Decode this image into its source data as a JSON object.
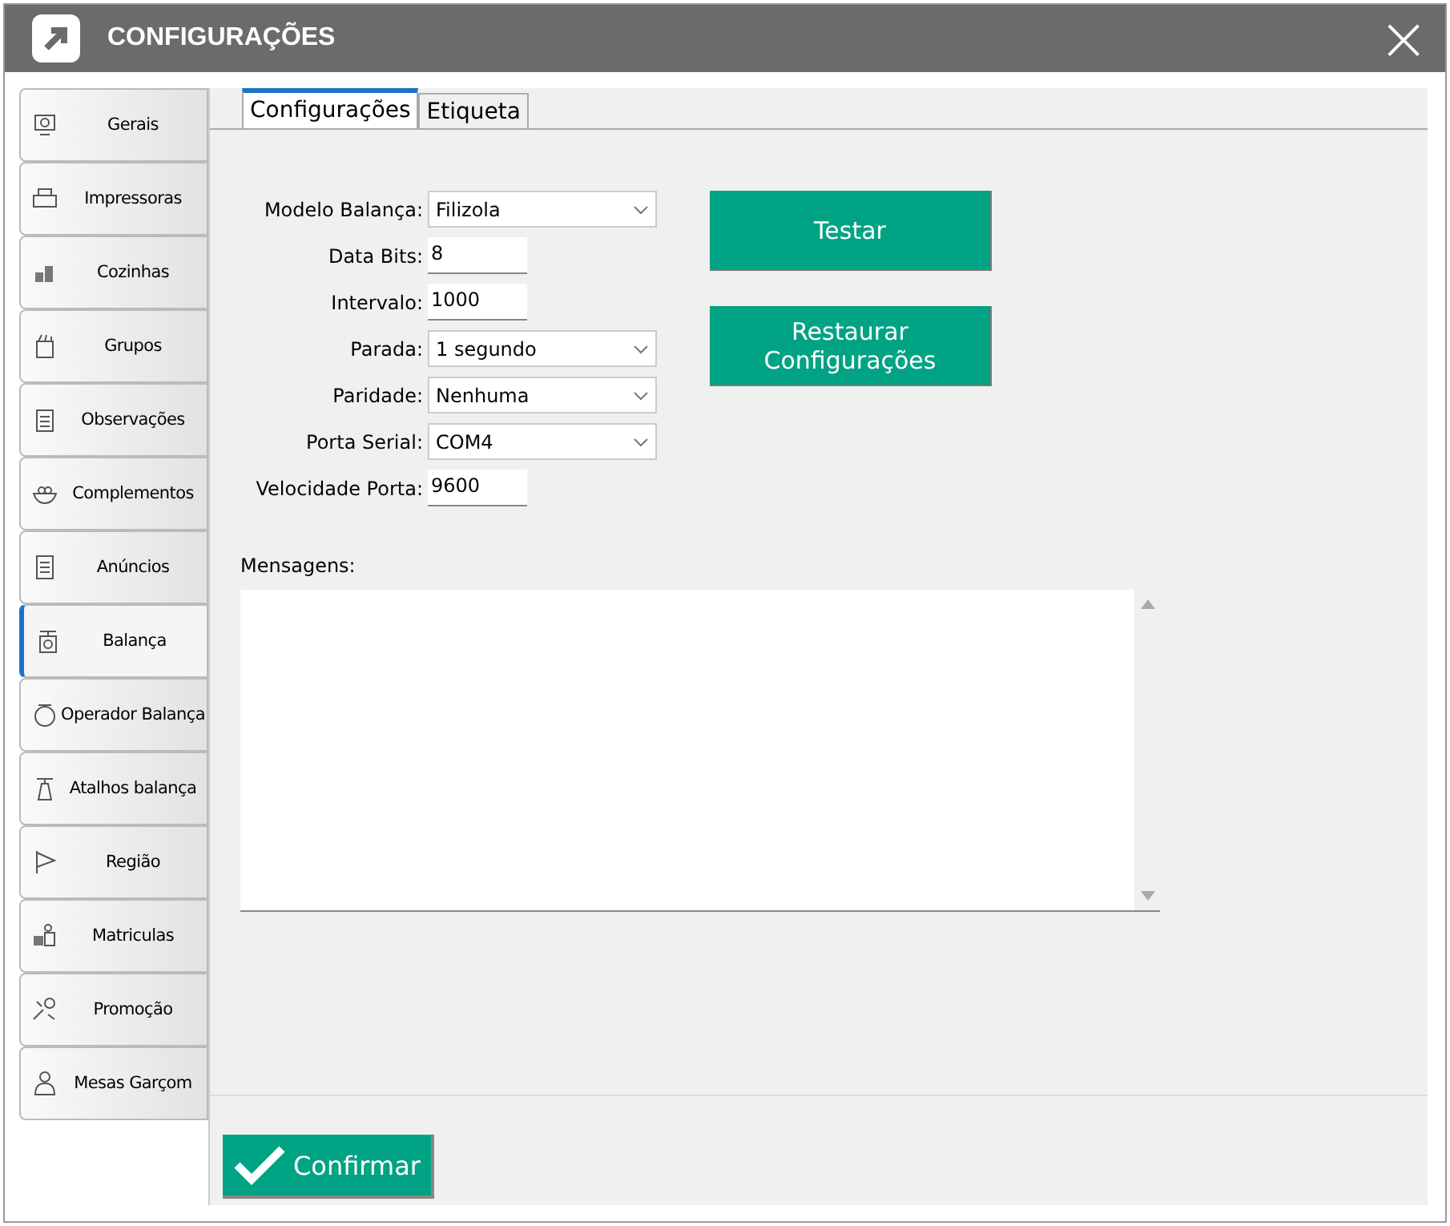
{
  "window": {
    "title": "CONFIGURAÇÕES",
    "close": "×"
  },
  "sidebar": {
    "items": [
      {
        "label": "Gerais",
        "selected": false
      },
      {
        "label": "Impressoras",
        "selected": false
      },
      {
        "label": "Cozinhas",
        "selected": false
      },
      {
        "label": "Grupos",
        "selected": false
      },
      {
        "label": "Observações",
        "selected": false
      },
      {
        "label": "Complementos",
        "selected": false
      },
      {
        "label": "Anúncios",
        "selected": false
      },
      {
        "label": "Balança",
        "selected": true
      },
      {
        "label": "Operador  Balança",
        "selected": false
      },
      {
        "label": "Atalhos balança",
        "selected": false
      },
      {
        "label": "Região",
        "selected": false
      },
      {
        "label": "Matriculas",
        "selected": false
      },
      {
        "label": "Promoção",
        "selected": false
      },
      {
        "label": "Mesas Garçom",
        "selected": false
      }
    ]
  },
  "tabs": [
    {
      "label": "Configurações",
      "selected": true
    },
    {
      "label": "Etiqueta",
      "selected": false
    }
  ],
  "form": [
    {
      "label": "Modelo Balança:",
      "kind": "select",
      "value": "Filizola"
    },
    {
      "label": "Data Bits:",
      "kind": "text",
      "value": "8"
    },
    {
      "label": "Intervalo:",
      "kind": "text",
      "value": "1000"
    },
    {
      "label": "Parada:",
      "kind": "select",
      "value": "1 segundo"
    },
    {
      "label": "Paridade:",
      "kind": "select",
      "value": "Nenhuma"
    },
    {
      "label": "Porta Serial:",
      "kind": "select",
      "value": "COM4"
    },
    {
      "label": "Velocidade Porta:",
      "kind": "text",
      "value": "9600"
    }
  ],
  "actions": [
    "Testar",
    "Restaurar Configurações"
  ],
  "messages": {
    "label": "Mensagens:"
  },
  "confirm": {
    "label": "Confirmar"
  }
}
